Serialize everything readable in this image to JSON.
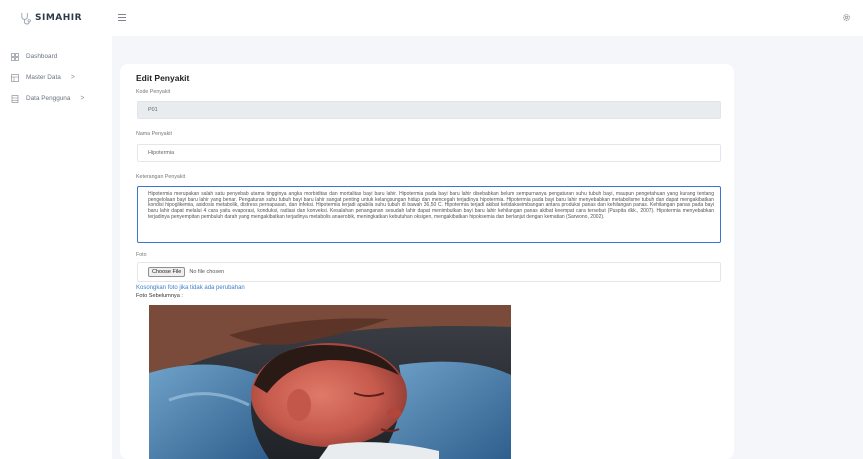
{
  "brand": {
    "name": "SIMAHIR",
    "icon": "stethoscope-logo-icon"
  },
  "sidebar": {
    "items": [
      {
        "label": "Dashboard",
        "icon": "dashboard-icon",
        "has_submenu": false
      },
      {
        "label": "Master Data",
        "icon": "table-icon",
        "has_submenu": true
      },
      {
        "label": "Data Pengguna",
        "icon": "users-table-icon",
        "has_submenu": true
      }
    ],
    "chevron": ">"
  },
  "header": {
    "menu_icon": "hamburger-icon",
    "settings_icon": "gear-icon"
  },
  "form": {
    "title": "Edit Penyakit",
    "kode_label": "Kode Penyakit",
    "kode_value": "P01",
    "nama_label": "Nama Penyakit",
    "nama_value": "Hipotermia",
    "keterangan_label": "Keterangan Penyakit",
    "keterangan_value": "Hipotermia merupakan salah satu penyebab utama tingginya angka morbiditas dan mortalitas bayi baru lahir. Hipotermia pada bayi baru lahir disebabkan belum sempurnanya pengaturan suhu tubuh bayi, maupun pengetahuan yang kurang tentang pengelolaan bayi baru lahir yang benar. Pengaturan suhu tubuh bayi baru lahir sangat penting untuk kelangsungan hidup dan mencegah terjadinya hipotermia. Hipotermia pada bayi baru lahir menyebabkan metabolisme tubuh dan dapat mengakibatkan kondisi hipoglikemia, asidosis metabolik, distress pernapasan, dan infeksi. Hipotermia terjadi apabila suhu tubuh di bawah 36,50 C. Hipotermia terjadi akibat ketidakseimbangan antara produksi panas dan kehilangan panas. Kehilangan panas pada bayi baru lahir dapat melalui 4 cara yaitu evaporasi, konduksi, radiasi dan konveksi. Kesalahan penanganan sesudah lahir dapat menimbulkan bayi baru lahir kehilangan panas akibat keempat cara tersebut (Puspita dkk., 2007). Hipotermia menyebabkan terjadinya penyempitan pembuluh darah yang mengakibatkan terjadinya metabolis anaerobik, meningkatkan kebutuhan oksigen, mengakibatkan hipoksemia dan berlanjut dengan kematian (Sarwono, 2002).",
    "foto_label": "Foto",
    "file_button": "Choose File",
    "file_status": "No file chosen",
    "hint": "Kosongkan foto jika tidak ada perubahan",
    "prev_label": "Foto Sebelumnya :"
  },
  "colors": {
    "accent": "#3b73d1",
    "hint": "#3e82c9",
    "background": "#f4f6f9"
  }
}
